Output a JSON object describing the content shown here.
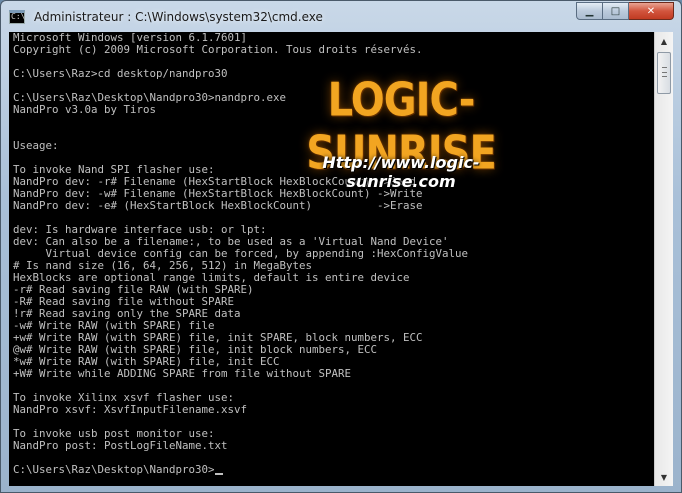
{
  "window": {
    "title": "Administrateur : C:\\Windows\\system32\\cmd.exe",
    "minimize_label": "▁",
    "maximize_label": "□",
    "close_label": "✕"
  },
  "watermark": {
    "logo": "LOGIC-SUNRISE",
    "url": "Http://www.logic-sunrise.com"
  },
  "console": {
    "lines": [
      "Microsoft Windows [version 6.1.7601]",
      "Copyright (c) 2009 Microsoft Corporation. Tous droits réservés.",
      "",
      "C:\\Users\\Raz>cd desktop/nandpro30",
      "",
      "C:\\Users\\Raz\\Desktop\\Nandpro30>nandpro.exe",
      "NandPro v3.0a by Tiros",
      "",
      "",
      "Useage:",
      "",
      "To invoke Nand SPI flasher use:",
      "NandPro dev: -r# Filename (HexStartBlock HexBlockCount) ->Read",
      "NandPro dev: -w# Filename (HexStartBlock HexBlockCount) ->Write",
      "NandPro dev: -e# (HexStartBlock HexBlockCount)          ->Erase",
      "",
      "dev: Is hardware interface usb: or lpt:",
      "dev: Can also be a filename:, to be used as a 'Virtual Nand Device'",
      "     Virtual device config can be forced, by appending :HexConfigValue",
      "# Is nand size (16, 64, 256, 512) in MegaBytes",
      "HexBlocks are optional range limits, default is entire device",
      "-r# Read saving file RAW (with SPARE)",
      "-R# Read saving file without SPARE",
      "!r# Read saving only the SPARE data",
      "-w# Write RAW (with SPARE) file",
      "+w# Write RAW (with SPARE) file, init SPARE, block numbers, ECC",
      "@w# Write RAW (with SPARE) file, init block numbers, ECC",
      "*w# Write RAW (with SPARE) file, init ECC",
      "+W# Write while ADDING SPARE from file without SPARE",
      "",
      "To invoke Xilinx xsvf flasher use:",
      "NandPro xsvf: XsvfInputFilename.xsvf",
      "",
      "To invoke usb post monitor use:",
      "NandPro post: PostLogFileName.txt",
      "",
      "C:\\Users\\Raz\\Desktop\\Nandpro30>"
    ]
  },
  "scrollbar": {
    "up_arrow": "▲",
    "down_arrow": "▼"
  }
}
